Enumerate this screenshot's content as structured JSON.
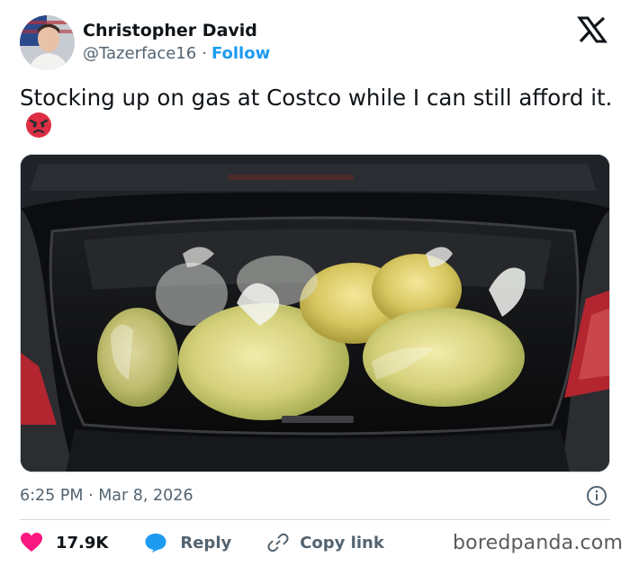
{
  "tweet": {
    "author_name": "Christopher David",
    "handle": "@Tazerface16",
    "separator": "·",
    "follow_label": "Follow",
    "text": "Stocking up on gas at Costco while I can still afford it.",
    "emoji": "angry-face",
    "media_description_icon": "car-trunk-photo",
    "timestamp": "6:25 PM · Mar 8, 2026"
  },
  "actions": {
    "likes_count": "17.9K",
    "reply_label": "Reply",
    "copy_link_label": "Copy link"
  },
  "watermark": "boredpanda.com",
  "colors": {
    "accent": "#1d9bf0",
    "like": "#f91880",
    "text_primary": "#0f1419",
    "text_secondary": "#536471"
  }
}
